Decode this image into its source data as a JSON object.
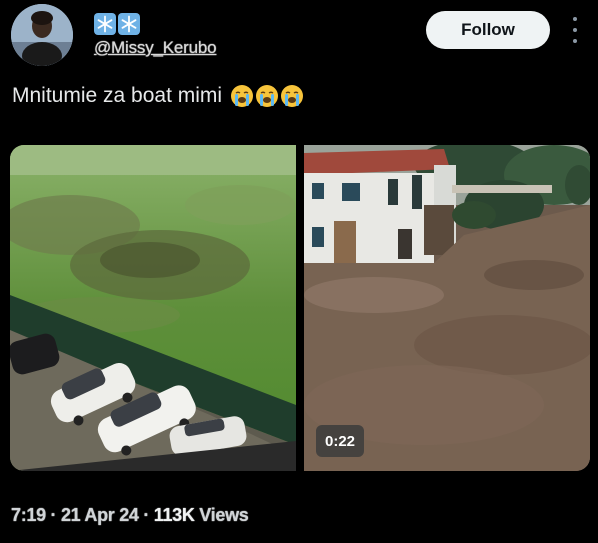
{
  "tweet": {
    "handle": "@Missy_Kerubo",
    "text": "Mnitumie za boat mimi",
    "display_name_icons": [
      "snowflake-icon",
      "snowflake-icon"
    ],
    "text_emojis": [
      "loudly-crying-face",
      "loudly-crying-face",
      "loudly-crying-face"
    ],
    "follow_label": "Follow",
    "media": {
      "video_duration": "0:22"
    },
    "meta": {
      "time": "7:19",
      "separator": "·",
      "date": "21 Apr 24",
      "views_count": "113K",
      "views_label": "Views"
    }
  },
  "colors": {
    "background": "#000000",
    "follow_bg": "#eff3f4",
    "snow_badge": "#6fb2e6",
    "text": "#e7e9ea"
  }
}
